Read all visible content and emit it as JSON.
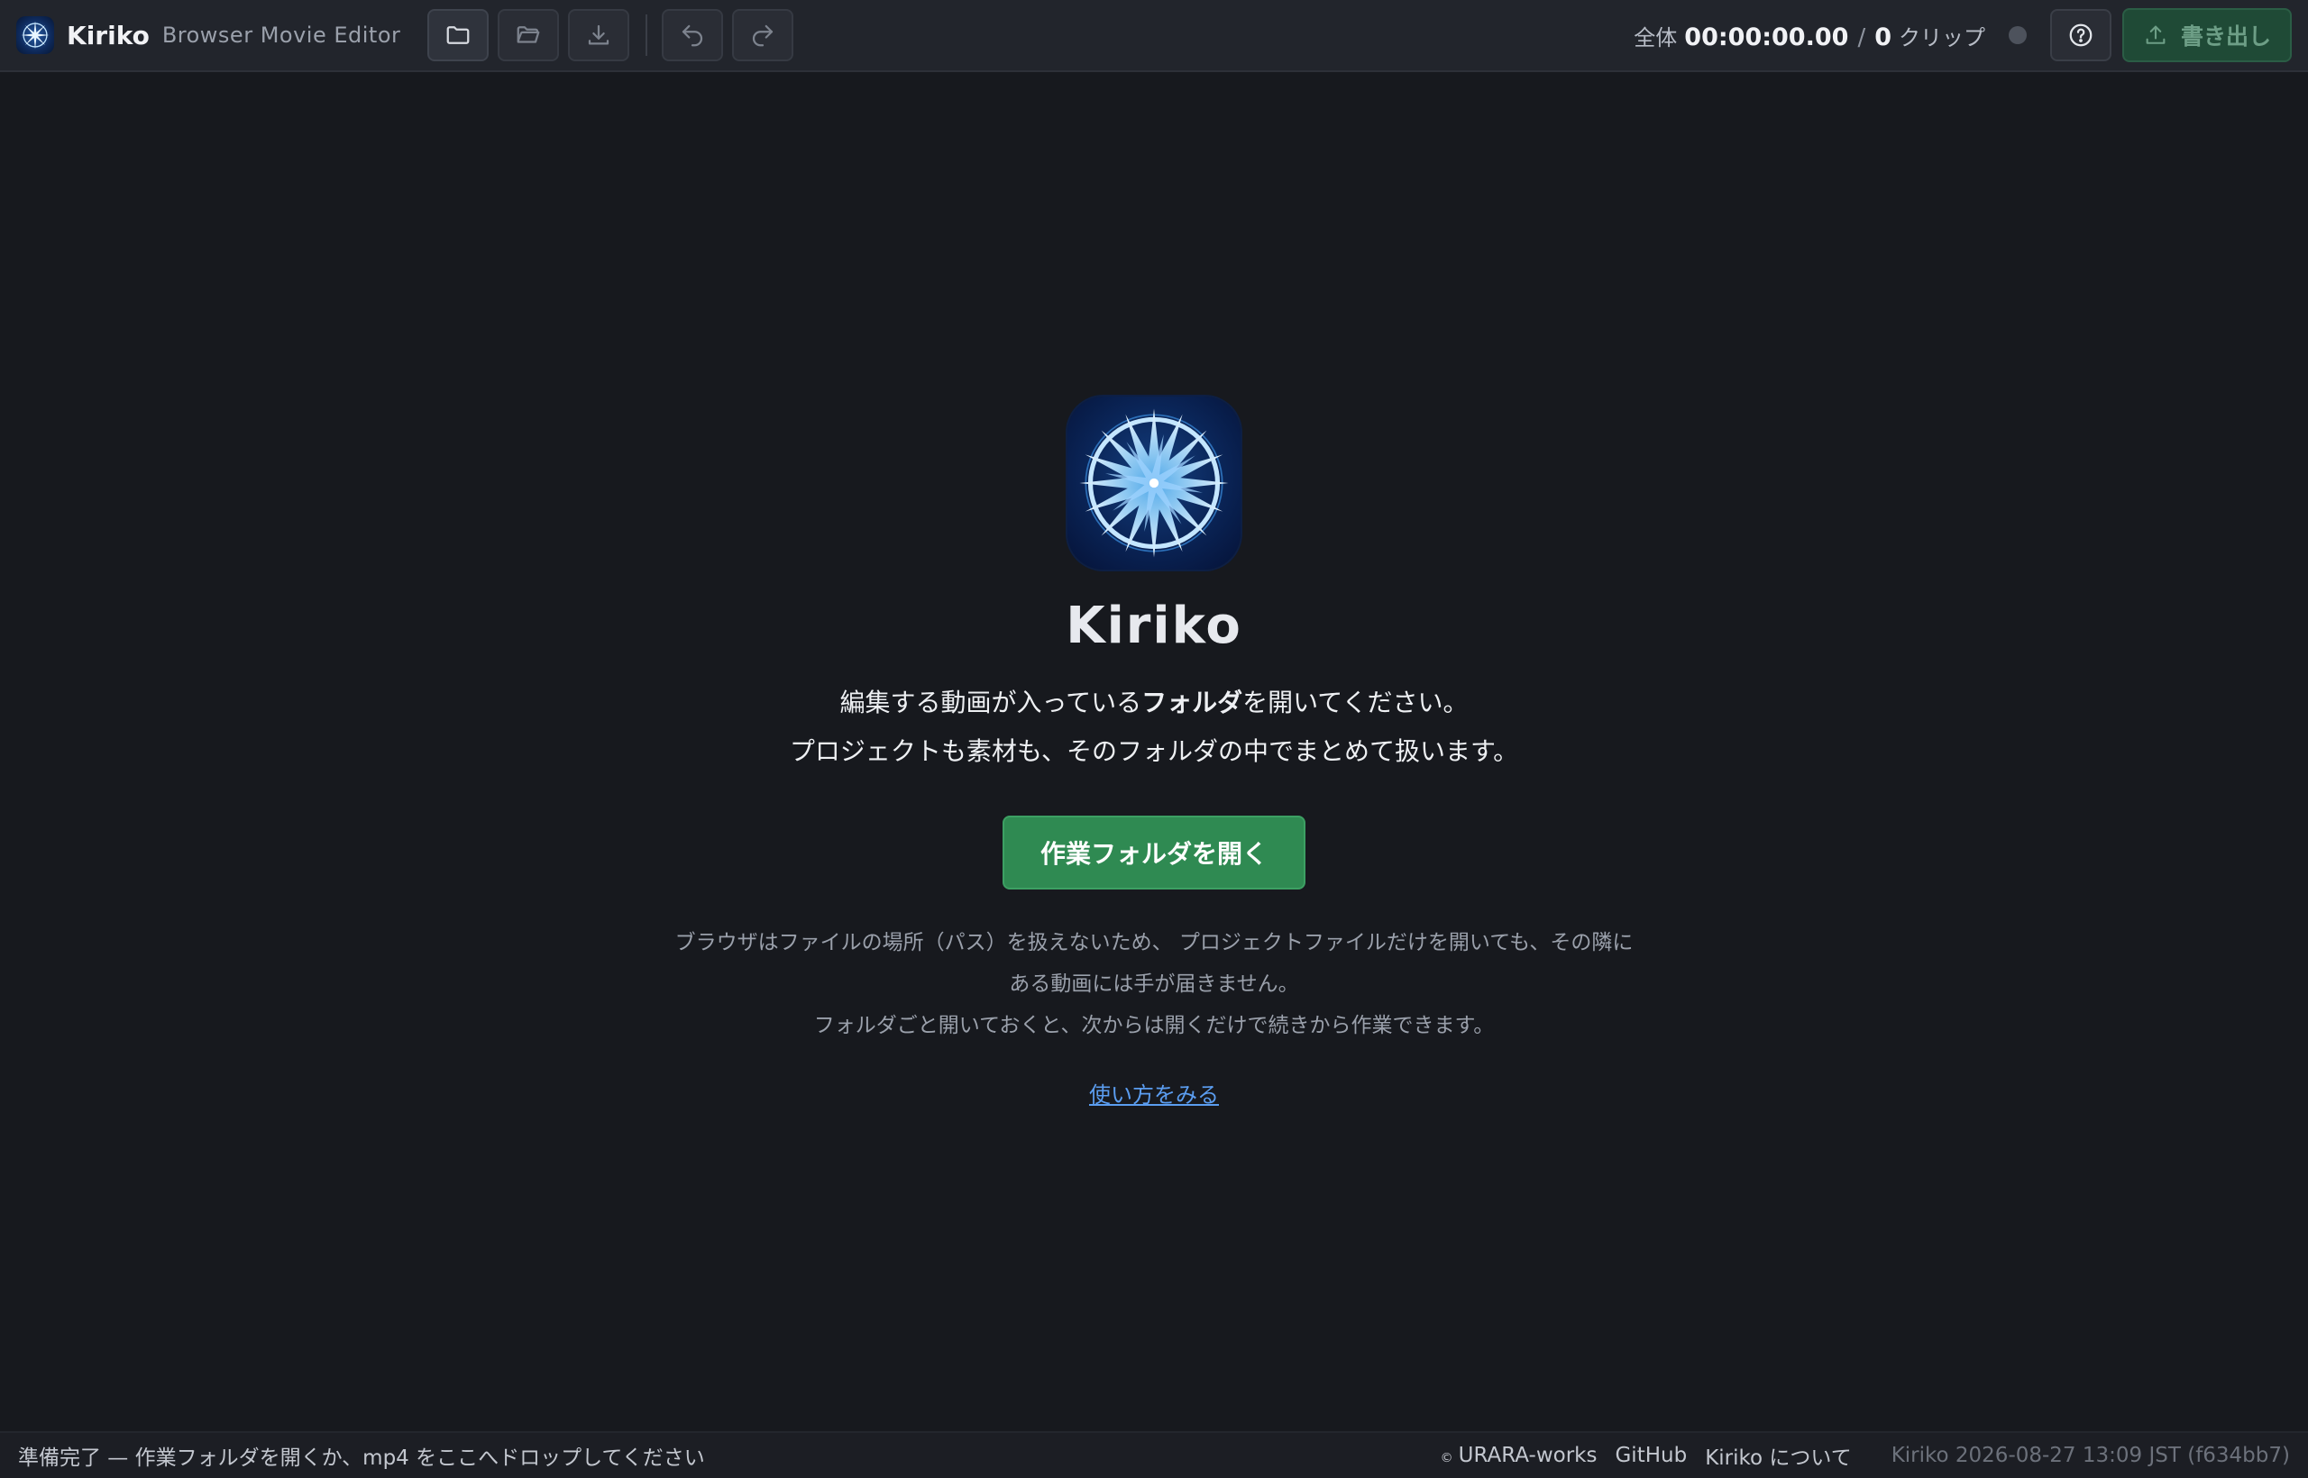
{
  "app": {
    "name": "Kiriko",
    "subtitle": "Browser Movie Editor"
  },
  "toolbar": {
    "buttons": [
      {
        "icon": "folder-icon",
        "name": "new-folder-button"
      },
      {
        "icon": "folder-open-icon",
        "name": "open-project-button"
      },
      {
        "icon": "download-icon",
        "name": "save-button"
      },
      {
        "icon": "undo-icon",
        "name": "undo-button"
      },
      {
        "icon": "redo-icon",
        "name": "redo-button"
      }
    ],
    "total_label": "全体",
    "total_time": "00:00:00.00",
    "slash": "/",
    "clip_count": "0",
    "clip_unit": "クリップ",
    "help_icon": "help-circle-icon",
    "export_label": "書き出し",
    "export_icon": "upload-icon"
  },
  "welcome": {
    "title": "Kiriko",
    "lead_line1_pre": "編集する動画が入っている",
    "lead_line1_bold": "フォルダ",
    "lead_line1_post": "を開いてください。",
    "lead_line2": "プロジェクトも素材も、そのフォルダの中でまとめて扱います。",
    "open_button": "作業フォルダを開く",
    "note_line1": "ブラウザはファイルの場所（パス）を扱えないため、 プロジェクトファイルだけを開いても、その隣に",
    "note_line2": "ある動画には手が届きません。",
    "note_line3": "フォルダごと開いておくと、次からは開くだけで続きから作業できます。",
    "howto_link": "使い方をみる"
  },
  "statusbar": {
    "message": "準備完了 — 作業フォルダを開くか、mp4 をここへドロップしてください",
    "copyright_symbol": "©",
    "copyright": "URARA-works",
    "github": "GitHub",
    "about": "Kiriko について",
    "build": "Kiriko 2026-08-27 13:09 JST (f634bb7)"
  },
  "colors": {
    "background": "#17191e",
    "toolbar": "#22252c",
    "primary_button": "#2f8a52",
    "link": "#5b9df0"
  }
}
